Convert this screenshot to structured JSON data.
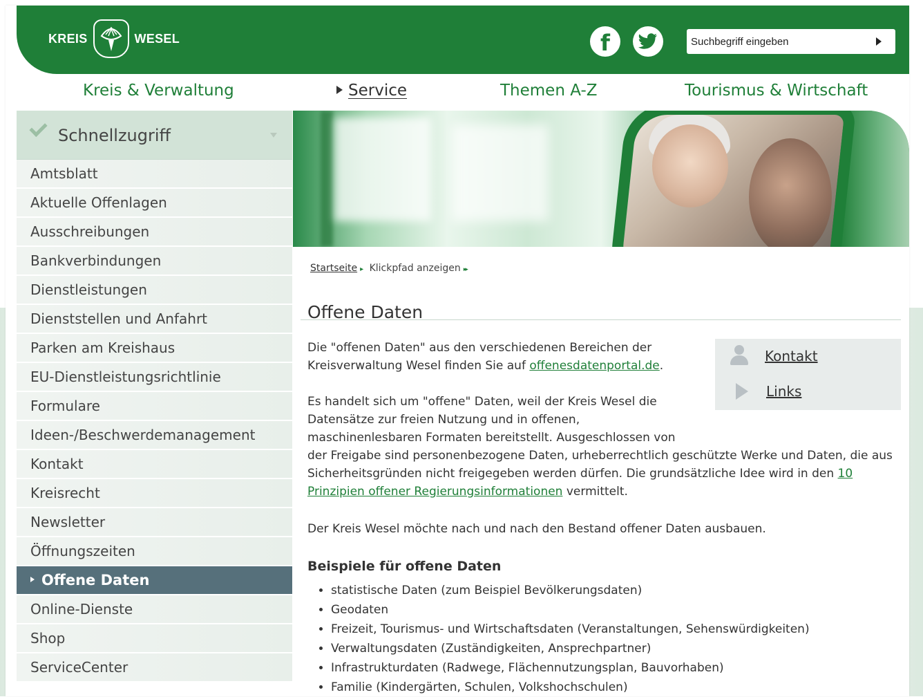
{
  "header": {
    "logo_left": "KREIS",
    "logo_right": "WESEL",
    "search_placeholder": "Suchbegriff eingeben",
    "social": [
      "facebook-icon",
      "twitter-icon"
    ]
  },
  "topnav": [
    {
      "label": "Kreis & Verwaltung"
    },
    {
      "label": "Service",
      "active": true
    },
    {
      "label": "Themen A-Z"
    },
    {
      "label": "Tourismus & Wirtschaft"
    }
  ],
  "sidebar": {
    "quick_label": "Schnellzugriff",
    "items": [
      {
        "label": "Amtsblatt"
      },
      {
        "label": "Aktuelle Offenlagen"
      },
      {
        "label": "Ausschreibungen"
      },
      {
        "label": "Bankverbindungen"
      },
      {
        "label": "Dienstleistungen"
      },
      {
        "label": "Dienststellen und Anfahrt"
      },
      {
        "label": "Parken am Kreishaus"
      },
      {
        "label": "EU-Dienstleistungsrichtlinie"
      },
      {
        "label": "Formulare"
      },
      {
        "label": "Ideen-/Beschwerdemanagement"
      },
      {
        "label": "Kontakt"
      },
      {
        "label": "Kreisrecht"
      },
      {
        "label": "Newsletter"
      },
      {
        "label": "Öffnungszeiten"
      },
      {
        "label": "Offene Daten",
        "active": true
      },
      {
        "label": "Online-Dienste"
      },
      {
        "label": "Shop"
      },
      {
        "label": "ServiceCenter"
      }
    ]
  },
  "breadcrumb": {
    "home": "Startseite",
    "path": "Klickpfad anzeigen"
  },
  "page": {
    "title": "Offene Daten",
    "p1_text": "Die \"offenen Daten\" aus den verschiedenen Bereichen der Kreisverwaltung Wesel finden Sie auf ",
    "p1_link": "offenesdatenportal.de",
    "p1_end": ".",
    "p2_text": "Es handelt sich um \"offene\" Daten, weil der Kreis Wesel die Datensätze zur freien Nutzung und in offenen, maschinenlesbaren Formaten bereitstellt. Ausgeschlossen von der Freigabe sind personenbezogene Daten, urheberrechtlich geschützte Werke und Daten, die aus Sicherheitsgründen nicht freigegeben werden dürfen. Die grundsätzliche Idee wird in den ",
    "p2_link": "10 Prinzipien offener Regierungsinformationen",
    "p2_end": " vermittelt.",
    "p3_text": "Der Kreis Wesel möchte nach und nach den Bestand offener Daten ausbauen.",
    "examples_heading": "Beispiele für offene Daten",
    "examples": [
      "statistische Daten (zum Beispiel Bevölkerungsdaten)",
      "Geodaten",
      "Freizeit, Tourismus- und Wirtschaftsdaten (Veranstaltungen, Sehenswürdigkeiten)",
      "Verwaltungsdaten (Zuständigkeiten, Ansprechpartner)",
      "Infrastrukturdaten (Radwege, Flächennutzungsplan, Bauvorhaben)",
      "Familie (Kindergärten, Schulen, Volkshochschulen)"
    ]
  },
  "sidebox": {
    "contact_label": "Kontakt",
    "links_label": "Links"
  },
  "colors": {
    "brand_green": "#1f7f38",
    "active_nav": "#56707b",
    "quick_bg": "#d2e3d7"
  }
}
